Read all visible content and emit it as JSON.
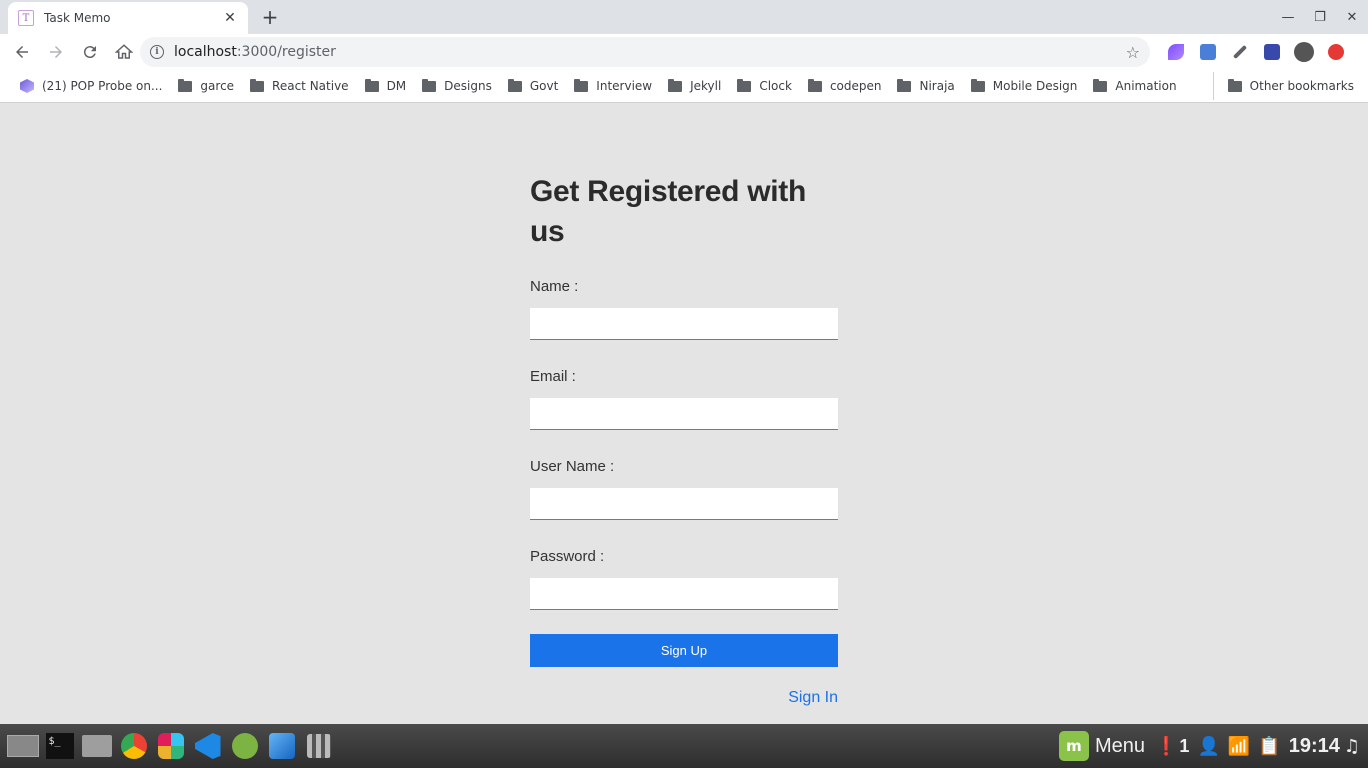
{
  "browser": {
    "tab": {
      "title": "Task Memo",
      "favicon_letter": "T",
      "close_glyph": "✕"
    },
    "new_tab_glyph": "+",
    "window_controls": {
      "minimize": "—",
      "maximize": "❐",
      "close": "✕"
    },
    "url": {
      "host": "localhost",
      "path": ":3000/register"
    },
    "bookmarks": [
      {
        "label": "(21) POP Probe on...",
        "icon": "favicon"
      },
      {
        "label": "garce",
        "icon": "folder"
      },
      {
        "label": "React Native",
        "icon": "folder"
      },
      {
        "label": "DM",
        "icon": "folder"
      },
      {
        "label": "Designs",
        "icon": "folder"
      },
      {
        "label": "Govt",
        "icon": "folder"
      },
      {
        "label": "Interview",
        "icon": "folder"
      },
      {
        "label": "Jekyll",
        "icon": "folder"
      },
      {
        "label": "Clock",
        "icon": "folder"
      },
      {
        "label": "codepen",
        "icon": "folder"
      },
      {
        "label": "Niraja",
        "icon": "folder"
      },
      {
        "label": "Mobile Design",
        "icon": "folder"
      },
      {
        "label": "Animation",
        "icon": "folder"
      }
    ],
    "other_bookmarks": "Other bookmarks"
  },
  "form": {
    "title": "Get Registered with us",
    "fields": [
      {
        "label": "Name :",
        "value": ""
      },
      {
        "label": "Email :",
        "value": ""
      },
      {
        "label": "User Name :",
        "value": ""
      },
      {
        "label": "Password :",
        "value": ""
      }
    ],
    "submit_label": "Sign Up",
    "signin_label": "Sign In"
  },
  "taskbar": {
    "menu_label": "Menu",
    "notification_count": "1",
    "clock": "19:14"
  },
  "colors": {
    "accent": "#1a73e8",
    "page_bg": "#e4e4e4",
    "input_border": "#4a7fd8"
  }
}
